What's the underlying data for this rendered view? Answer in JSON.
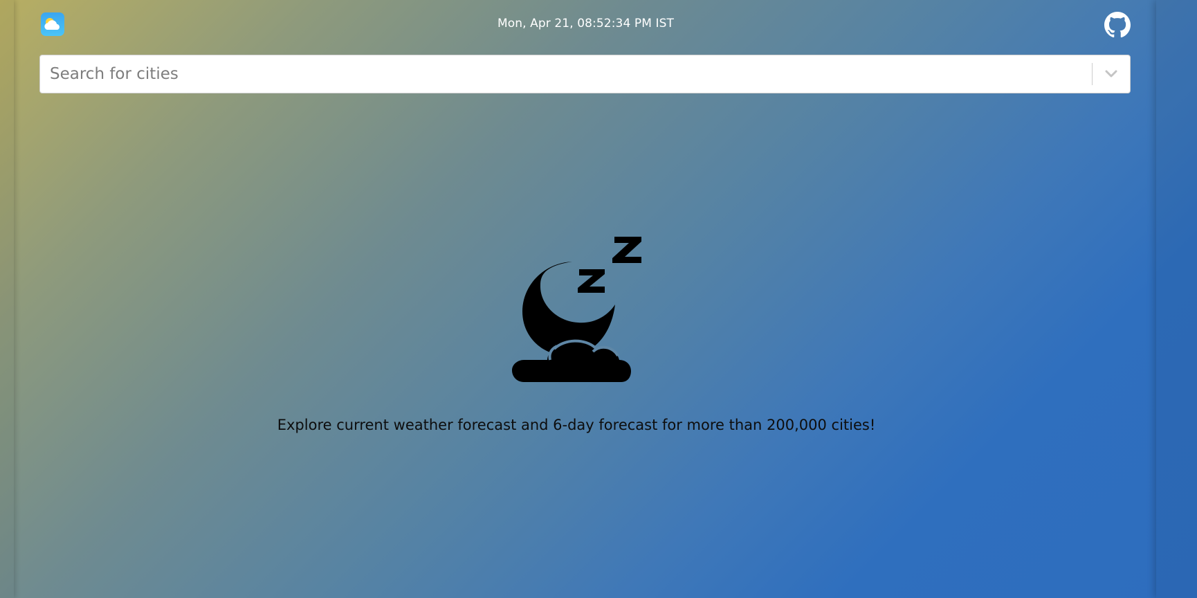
{
  "header": {
    "logo_icon": "weather-app-icon",
    "datetime": "Mon, Apr 21, 08:52:34 PM IST",
    "github_icon": "github-icon"
  },
  "search": {
    "placeholder": "Search for cities",
    "value": "",
    "dropdown_icon": "chevron-down-icon"
  },
  "main": {
    "illustration_icon": "sleeping-moon-cloud-icon",
    "tagline": "Explore current weather forecast and 6-day forecast for more than 200,000 cities!"
  },
  "colors": {
    "gradient_start": "#b8ae62",
    "gradient_end": "#2e6dbe",
    "text_dark": "#0d0d0d",
    "text_light": "#ffffff"
  }
}
